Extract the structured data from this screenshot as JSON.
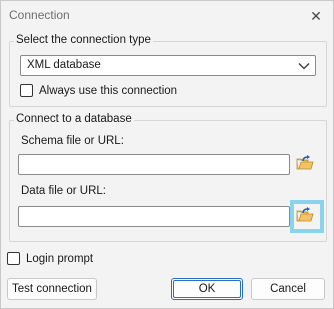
{
  "window": {
    "title": "Connection",
    "close_glyph": "✕"
  },
  "connection_type": {
    "group_label": "Select the connection type",
    "selected_value": "XML database",
    "always_use_label": "Always use this connection",
    "always_use_checked": false
  },
  "connect_db": {
    "group_label": "Connect to a database",
    "schema_label": "Schema file or URL:",
    "schema_value": "",
    "data_label": "Data file or URL:",
    "data_value": ""
  },
  "login_prompt": {
    "label": "Login prompt",
    "checked": false
  },
  "buttons": {
    "test_connection": "Test connection",
    "ok": "OK",
    "cancel": "Cancel"
  },
  "colors": {
    "highlight": "#89d3ec",
    "ok_border": "#2a6fc0"
  },
  "icons": {
    "browse": "folder-open-arrow-icon",
    "dropdown": "chevron-down-icon",
    "close": "close-icon"
  }
}
